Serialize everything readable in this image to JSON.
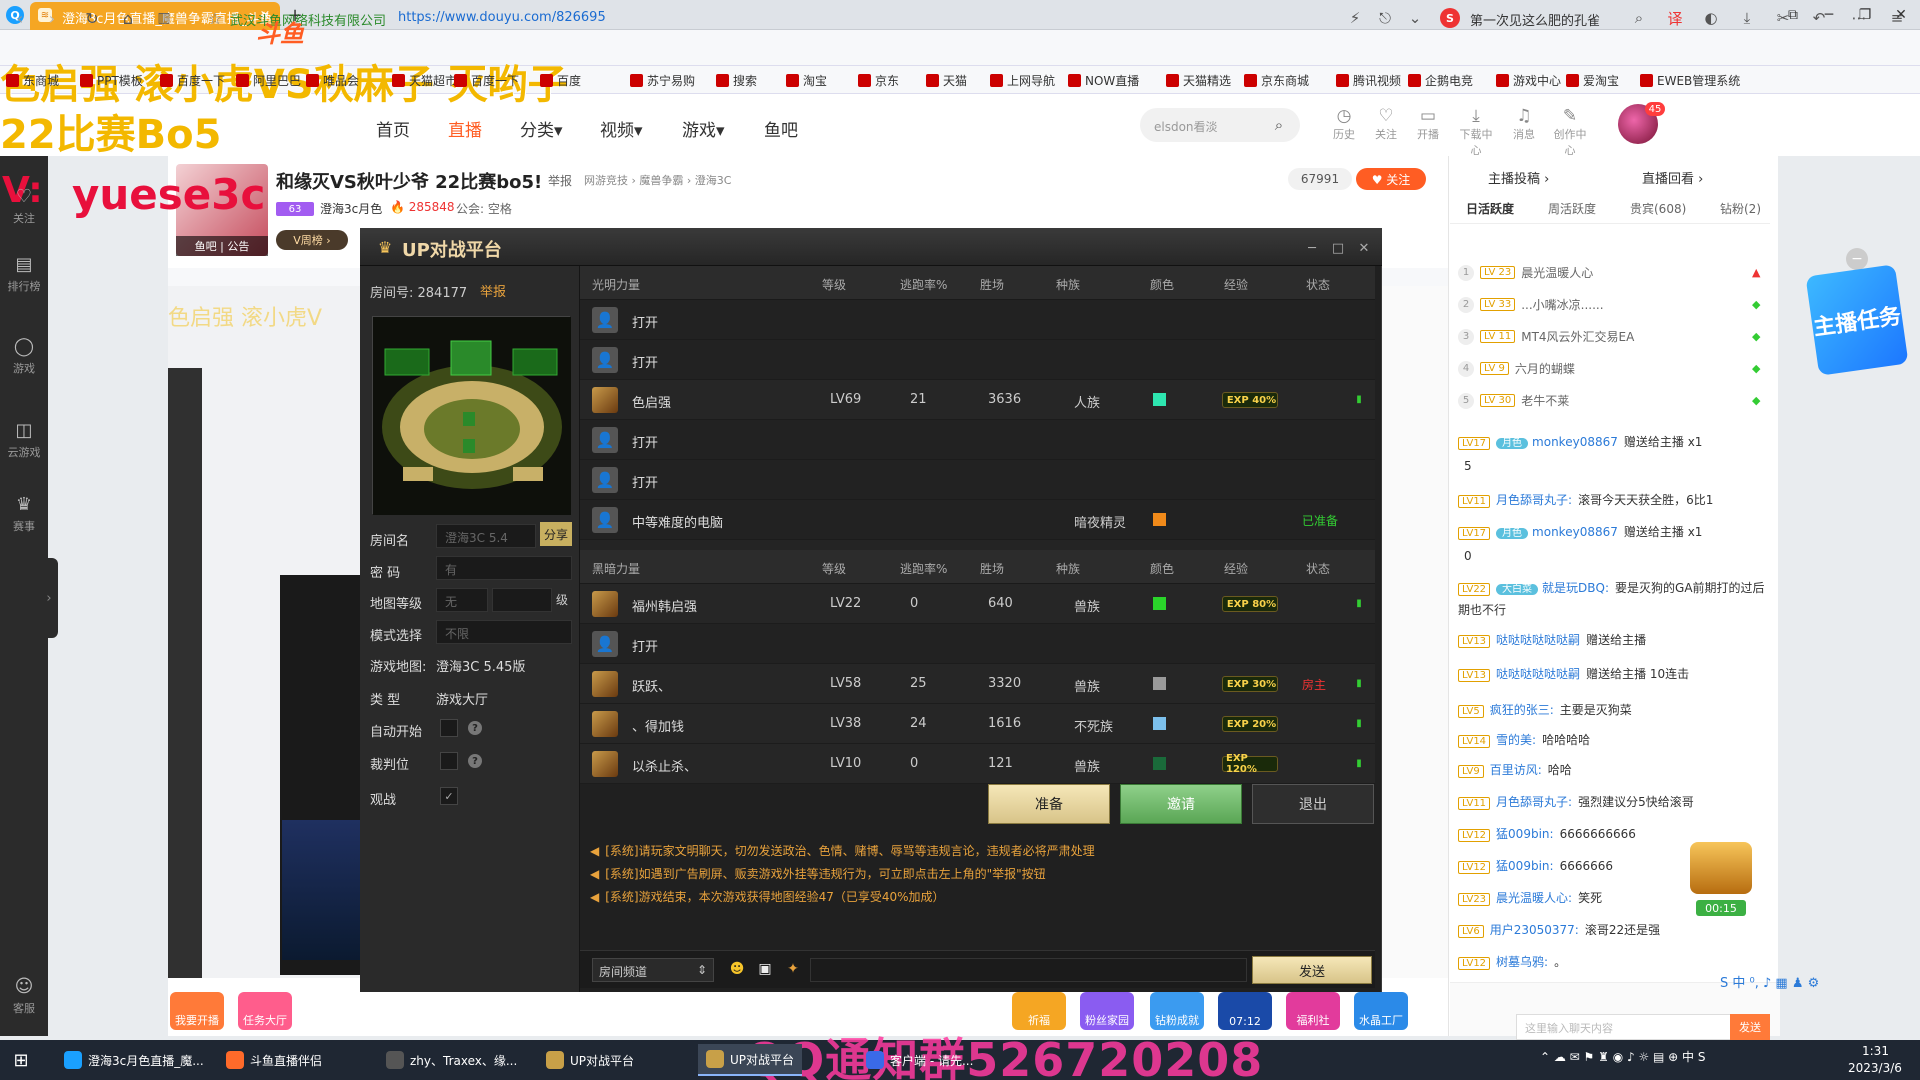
{
  "browser": {
    "logo_glyph": "Q",
    "tab_title": "澄海3c月色直播_魔兽争霸直播_斗鱼",
    "tab_favicon_glyph": "≋",
    "tab_close": "×",
    "tab_new": "+",
    "win_buttons": [
      "⧉",
      "─",
      "❐",
      "✕"
    ],
    "nav": {
      "back": "‹",
      "forward": "›",
      "reload": "↻",
      "home": "⌂",
      "read": "▥",
      "star": "☆"
    },
    "site_owner": "武汉斗鱼网络科技有限公司",
    "url": "https://www.douyu.com/826695",
    "search_engine_glyph": "S",
    "search_hint": "第一次见这么肥的孔雀",
    "addr_icons": [
      "⚡",
      "⎋",
      "⌄",
      "⌕",
      "译",
      "◐",
      "⤓",
      "✂",
      "↶",
      "⋯",
      "≡"
    ]
  },
  "bookmarks": [
    "东商城",
    "PPT模板",
    "百度一下",
    "阿里巴巴",
    "唯品会",
    "天猫超市",
    "百度一下",
    "百度",
    "苏宁易购",
    "搜索",
    "淘宝",
    "京东",
    "天猫",
    "上网导航",
    "NOW直播",
    "天猫精选",
    "京东商城",
    "腾讯视频",
    "企鹅电竞",
    "游戏中心",
    "爱淘宝",
    "EWEB管理系统"
  ],
  "overlays": {
    "line1": "色启强 滚小虎VS秋麻子 灭哟子",
    "line2": "22比赛Bo5",
    "v_mark": "V:",
    "wechat": "yuese3c",
    "qq": "QQ通知群526720208"
  },
  "site": {
    "logo": "斗鱼",
    "nav": [
      "首页",
      "直播",
      "分类▾",
      "视频▾",
      "游戏▾",
      "鱼吧"
    ],
    "search_placeholder": "elsdon看淡",
    "search_icon": "⌕",
    "header_icons": [
      {
        "glyph": "◷",
        "label": "历史"
      },
      {
        "glyph": "♡",
        "label": "关注"
      },
      {
        "glyph": "▭",
        "label": "开播"
      },
      {
        "glyph": "⤓",
        "label": "下载中心"
      },
      {
        "glyph": "♫",
        "label": "消息"
      },
      {
        "glyph": "✎",
        "label": "创作中心"
      }
    ],
    "avatar_badge": "45"
  },
  "left_sidebar": [
    {
      "glyph": "♡",
      "label": "关注"
    },
    {
      "glyph": "▤",
      "label": "排行榜"
    },
    {
      "glyph": "◯",
      "label": "游戏"
    },
    {
      "glyph": "◫",
      "label": "云游戏"
    },
    {
      "glyph": "♛",
      "label": "赛事"
    },
    {
      "glyph": "☺",
      "label": "客服"
    }
  ],
  "left_collapse": "›",
  "stream": {
    "title": "和缘灭VS秋叶少爷 22比赛bo5!",
    "report": "举报",
    "crumbs": "网游竞技 › 魔兽争霸 › 澄海3C",
    "follower_count": "67991",
    "follow_btn": "♥ 关注",
    "lv_badge": "63",
    "anchor": "澄海3c月色",
    "hot": "🔥 285848",
    "union": "公会: 空格",
    "avatar_tag": "鱼吧 | 公告",
    "vtag": "V周榜 ›"
  },
  "inner_title": "色启强 滚小虎V",
  "up": {
    "logo_glyph": "♛",
    "title": "UP对战平台",
    "win_buttons": [
      "─",
      "□",
      "✕"
    ],
    "room_no_label": "房间号: 284177",
    "room_report": "举报",
    "fields": {
      "room_name_label": "房间名",
      "room_name_value": "澄海3C 5.4",
      "share": "分享",
      "password_label": "密  码",
      "password_value": "有",
      "map_level_label": "地图等级",
      "map_level_value": "无",
      "map_level_unit": "级",
      "mode_label": "模式选择",
      "mode_value": "不限",
      "game_map_label": "游戏地图:",
      "game_map_value": "澄海3C 5.45版",
      "type_label": "类  型",
      "type_value": "游戏大厅",
      "auto_start_label": "自动开始",
      "referee_label": "裁判位",
      "watch_label": "观战",
      "help": "?",
      "check": "✓"
    },
    "columns": [
      "等级",
      "逃跑率%",
      "胜场",
      "种族",
      "颜色",
      "经验",
      "状态"
    ],
    "team_light": "光明力量",
    "team_dark": "黑暗力量",
    "light_players": [
      {
        "name": "打开",
        "level": "",
        "escape": "",
        "wins": "",
        "race": "",
        "color": "",
        "exp": "",
        "state": "",
        "hero": false
      },
      {
        "name": "打开",
        "level": "",
        "escape": "",
        "wins": "",
        "race": "",
        "color": "",
        "exp": "",
        "state": "",
        "hero": false
      },
      {
        "name": "色启强",
        "level": "LV69",
        "escape": "21",
        "wins": "3636",
        "race": "人族",
        "color": "#2ee6b0",
        "exp": "EXP 40%",
        "state": "",
        "hero": true
      },
      {
        "name": "打开",
        "level": "",
        "escape": "",
        "wins": "",
        "race": "",
        "color": "",
        "exp": "",
        "state": "",
        "hero": false
      },
      {
        "name": "打开",
        "level": "",
        "escape": "",
        "wins": "",
        "race": "",
        "color": "",
        "exp": "",
        "state": "",
        "hero": false
      },
      {
        "name": "中等难度的电脑",
        "level": "",
        "escape": "",
        "wins": "",
        "race": "暗夜精灵",
        "color": "#f08a1a",
        "exp": "",
        "state": "已准备",
        "hero": false
      }
    ],
    "dark_players": [
      {
        "name": "福州韩启强",
        "level": "LV22",
        "escape": "0",
        "wins": "640",
        "race": "兽族",
        "color": "#2ad42a",
        "exp": "EXP 80%",
        "state": "",
        "hero": true
      },
      {
        "name": "打开",
        "level": "",
        "escape": "",
        "wins": "",
        "race": "",
        "color": "",
        "exp": "",
        "state": "",
        "hero": false
      },
      {
        "name": "跃跃、",
        "level": "LV58",
        "escape": "25",
        "wins": "3320",
        "race": "兽族",
        "color": "#9a9a9a",
        "exp": "EXP 30%",
        "state": "房主",
        "hero": true
      },
      {
        "name": "、得加钱",
        "level": "LV38",
        "escape": "24",
        "wins": "1616",
        "race": "不死族",
        "color": "#7cc0ec",
        "exp": "EXP 20%",
        "state": "",
        "hero": true
      },
      {
        "name": "以杀止杀、",
        "level": "LV10",
        "escape": "0",
        "wins": "121",
        "race": "兽族",
        "color": "#1a6a3a",
        "exp": "EXP 120%",
        "state": "",
        "hero": true
      }
    ],
    "empty_avatar_glyph": "👤",
    "signal_glyph": "▮",
    "buttons": {
      "ready": "准备",
      "invite": "邀请",
      "exit": "退出"
    },
    "sys_icon": "◀",
    "sys_msgs": [
      "[系统]请玩家文明聊天，切勿发送政治、色情、赌博、辱骂等违规言论，违规者必将严肃处理",
      "[系统]如遇到广告刷屏、贩卖游戏外挂等违规行为，可立即点击左上角的\"举报\"按钮",
      "[系统]游戏结束，本次游戏获得地图经验47（已享受40%加成）"
    ],
    "channel": "房间频道",
    "channel_arrow": "⇕",
    "emoji": [
      "☻",
      "▣",
      "✦"
    ],
    "send": "发送"
  },
  "right_panel": {
    "top_tabs": [
      "主播投稿 ›",
      "直播回看 ›"
    ],
    "tabs": [
      "日活跃度",
      "周活跃度",
      "贵宾(608)",
      "钻粉(2)"
    ],
    "ranks": [
      {
        "n": "1",
        "lv": "LV 23",
        "name": "晨光温暖人心",
        "arrow": "▲",
        "arrow_color": "#e33"
      },
      {
        "n": "2",
        "lv": "LV 33",
        "name": "...小嘴冰凉......",
        "arrow": "◆",
        "arrow_color": "#3c3"
      },
      {
        "n": "3",
        "lv": "LV 11",
        "name": "MT4风云外汇交易EA",
        "arrow": "◆",
        "arrow_color": "#3c3"
      },
      {
        "n": "4",
        "lv": "LV 9",
        "name": "六月的蝴蝶",
        "arrow": "◆",
        "arrow_color": "#3c3"
      },
      {
        "n": "5",
        "lv": "LV 30",
        "name": "老牛不莱",
        "arrow": "◆",
        "arrow_color": "#3c3"
      }
    ],
    "messages": [
      {
        "lv": "LV17",
        "fan": "月色",
        "user": "monkey08867",
        "text": "赠送给主播 x1"
      },
      {
        "lv": "",
        "fan": "",
        "user": "",
        "text": "5"
      },
      {
        "lv": "LV11",
        "fan": "",
        "user": "月色舔哥丸子:",
        "text": "滚哥今天天获全胜，6比1"
      },
      {
        "lv": "LV17",
        "fan": "月色",
        "user": "monkey08867",
        "text": "赠送给主播 x1"
      },
      {
        "lv": "",
        "fan": "",
        "user": "",
        "text": "0"
      },
      {
        "lv": "LV22",
        "fan": "大白菜",
        "user": "就是玩DBQ:",
        "text": "要是灭狗的GA前期打的过后期也不行"
      },
      {
        "lv": "LV13",
        "fan": "",
        "user": "哒哒哒哒哒哒嗣",
        "text": "赠送给主播"
      },
      {
        "lv": "LV13",
        "fan": "",
        "user": "哒哒哒哒哒哒嗣",
        "text": "赠送给主播 10连击"
      },
      {
        "lv": "LV5",
        "fan": "",
        "user": "疯狂的张三:",
        "text": "主要是灭狗菜"
      },
      {
        "lv": "LV14",
        "fan": "",
        "user": "雪的美:",
        "text": "哈哈哈哈"
      },
      {
        "lv": "LV9",
        "fan": "",
        "user": "百里访风:",
        "text": "哈哈"
      },
      {
        "lv": "LV11",
        "fan": "",
        "user": "月色舔哥丸子:",
        "text": "强烈建议分5快给滚哥"
      },
      {
        "lv": "LV12",
        "fan": "",
        "user": "猛009bin:",
        "text": "6666666666"
      },
      {
        "lv": "LV12",
        "fan": "",
        "user": "猛009bin:",
        "text": "6666666"
      },
      {
        "lv": "LV23",
        "fan": "",
        "user": "晨光温暖人心:",
        "text": "笑死"
      },
      {
        "lv": "LV6",
        "fan": "",
        "user": "用户23050377:",
        "text": "滚哥22还是强"
      },
      {
        "lv": "LV12",
        "fan": "",
        "user": "树墓乌鸦:",
        "text": "。"
      }
    ],
    "treasure_time": "00:15",
    "chat_placeholder": "这里输入聊天内容",
    "chat_send": "发送",
    "close": "−",
    "promo": "主播任务",
    "sys_icons": "S 中 ⁰, ♪ ▦ ♟ ⚙"
  },
  "bottom_acts": [
    {
      "label": "我要开播",
      "color": "#ff7a39"
    },
    {
      "label": "任务大厅",
      "color": "#ff5d8c"
    },
    {
      "label": "祈福",
      "color": "#f5a623"
    },
    {
      "label": "粉丝家园",
      "color": "#8a5cf1"
    },
    {
      "label": "钻粉成就",
      "color": "#3b9bf0"
    },
    {
      "label": "07:12",
      "color": "#1a4aa8"
    },
    {
      "label": "福利社",
      "color": "#e23b9c"
    },
    {
      "label": "水晶工厂",
      "color": "#2b8ae8"
    }
  ],
  "taskbar": {
    "start": "⊞",
    "items": [
      {
        "label": "澄海3c月色直播_魔...",
        "color": "#1aa0ff",
        "on": false
      },
      {
        "label": "斗鱼直播伴侣",
        "color": "#ff6a2a",
        "on": false
      },
      {
        "label": "zhy、Traxex、缘...",
        "color": "#555",
        "on": false
      },
      {
        "label": "UP对战平台",
        "color": "#c8a048",
        "on": false
      },
      {
        "label": "UP对战平台",
        "color": "#c8a048",
        "on": true
      },
      {
        "label": "客户端 - 请先...",
        "color": "#3a6ae8",
        "on": false
      }
    ],
    "tray": "⌃ ☁ ✉ ⚑ ♜ ◉ ♪ ☼ ▤ ⊕ 中 S",
    "time": "1:31",
    "date": "2023/3/6"
  }
}
